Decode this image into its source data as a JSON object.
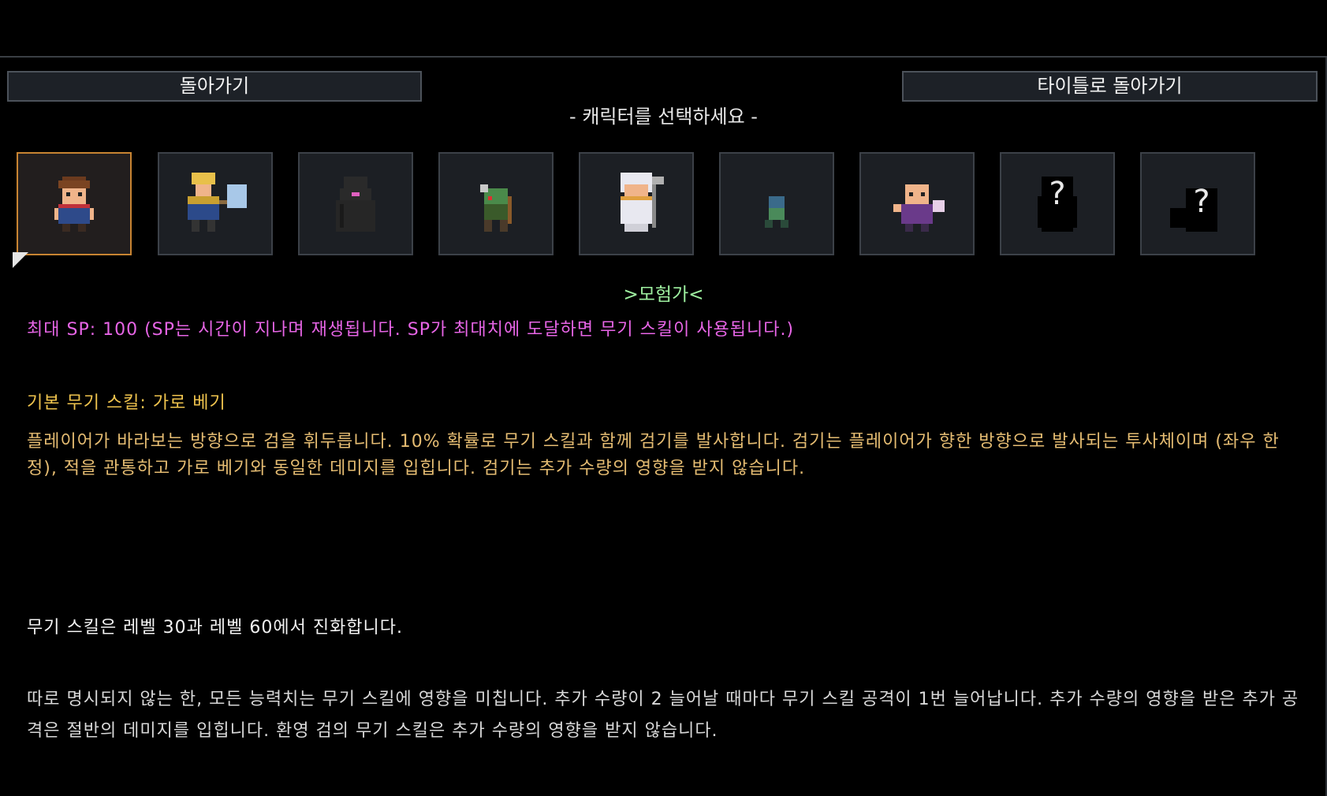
{
  "header": {
    "back_label": "돌아가기",
    "title_label": "타이틀로 돌아가기",
    "subtitle": "- 캐릭터를 선택하세요 -"
  },
  "characters": [
    {
      "icon": "adventurer-icon",
      "selected": true
    },
    {
      "icon": "hammer-knight-icon",
      "selected": false
    },
    {
      "icon": "hooded-figure-icon",
      "selected": false
    },
    {
      "icon": "goblin-archer-icon",
      "selected": false
    },
    {
      "icon": "priestess-icon",
      "selected": false
    },
    {
      "icon": "small-goblin-icon",
      "selected": false
    },
    {
      "icon": "mage-icon",
      "selected": false
    },
    {
      "icon": "locked-character-icon",
      "selected": false
    },
    {
      "icon": "locked-character-icon",
      "selected": false
    }
  ],
  "detail": {
    "name": ">모험가<",
    "sp_line": "최대 SP: 100 (SP는 시간이 지나며 재생됩니다. SP가 최대치에 도달하면 무기 스킬이 사용됩니다.)",
    "skill_title": "기본 무기 스킬: 가로 베기",
    "skill_desc": "플레이어가 바라보는 방향으로 검을 휘두릅니다. 10% 확률로 무기 스킬과 함께 검기를 발사합니다. 검기는 플레이어가 향한 방향으로 발사되는 투사체이며 (좌우 한정), 적을 관통하고 가로 베기와 동일한 데미지를 입힙니다. 검기는 추가 수량의 영향을 받지 않습니다.",
    "evolve": "무기 스킬은 레벨 30과 레벨 60에서 진화합니다.",
    "note": "따로 명시되지 않는 한, 모든 능력치는 무기 스킬에 영향을 미칩니다. 추가 수량이 2 늘어날 때마다 무기 스킬 공격이 1번 늘어납니다. 추가 수량의 영향을 받은 추가 공격은 절반의 데미지를 입힙니다. 환영 검의 무기 스킬은 추가 수량의 영향을 받지 않습니다."
  },
  "colors": {
    "sp": "#e765e6",
    "skill_title": "#f0c44e",
    "name": "#9ef0a0",
    "selected_border": "#c88432"
  }
}
